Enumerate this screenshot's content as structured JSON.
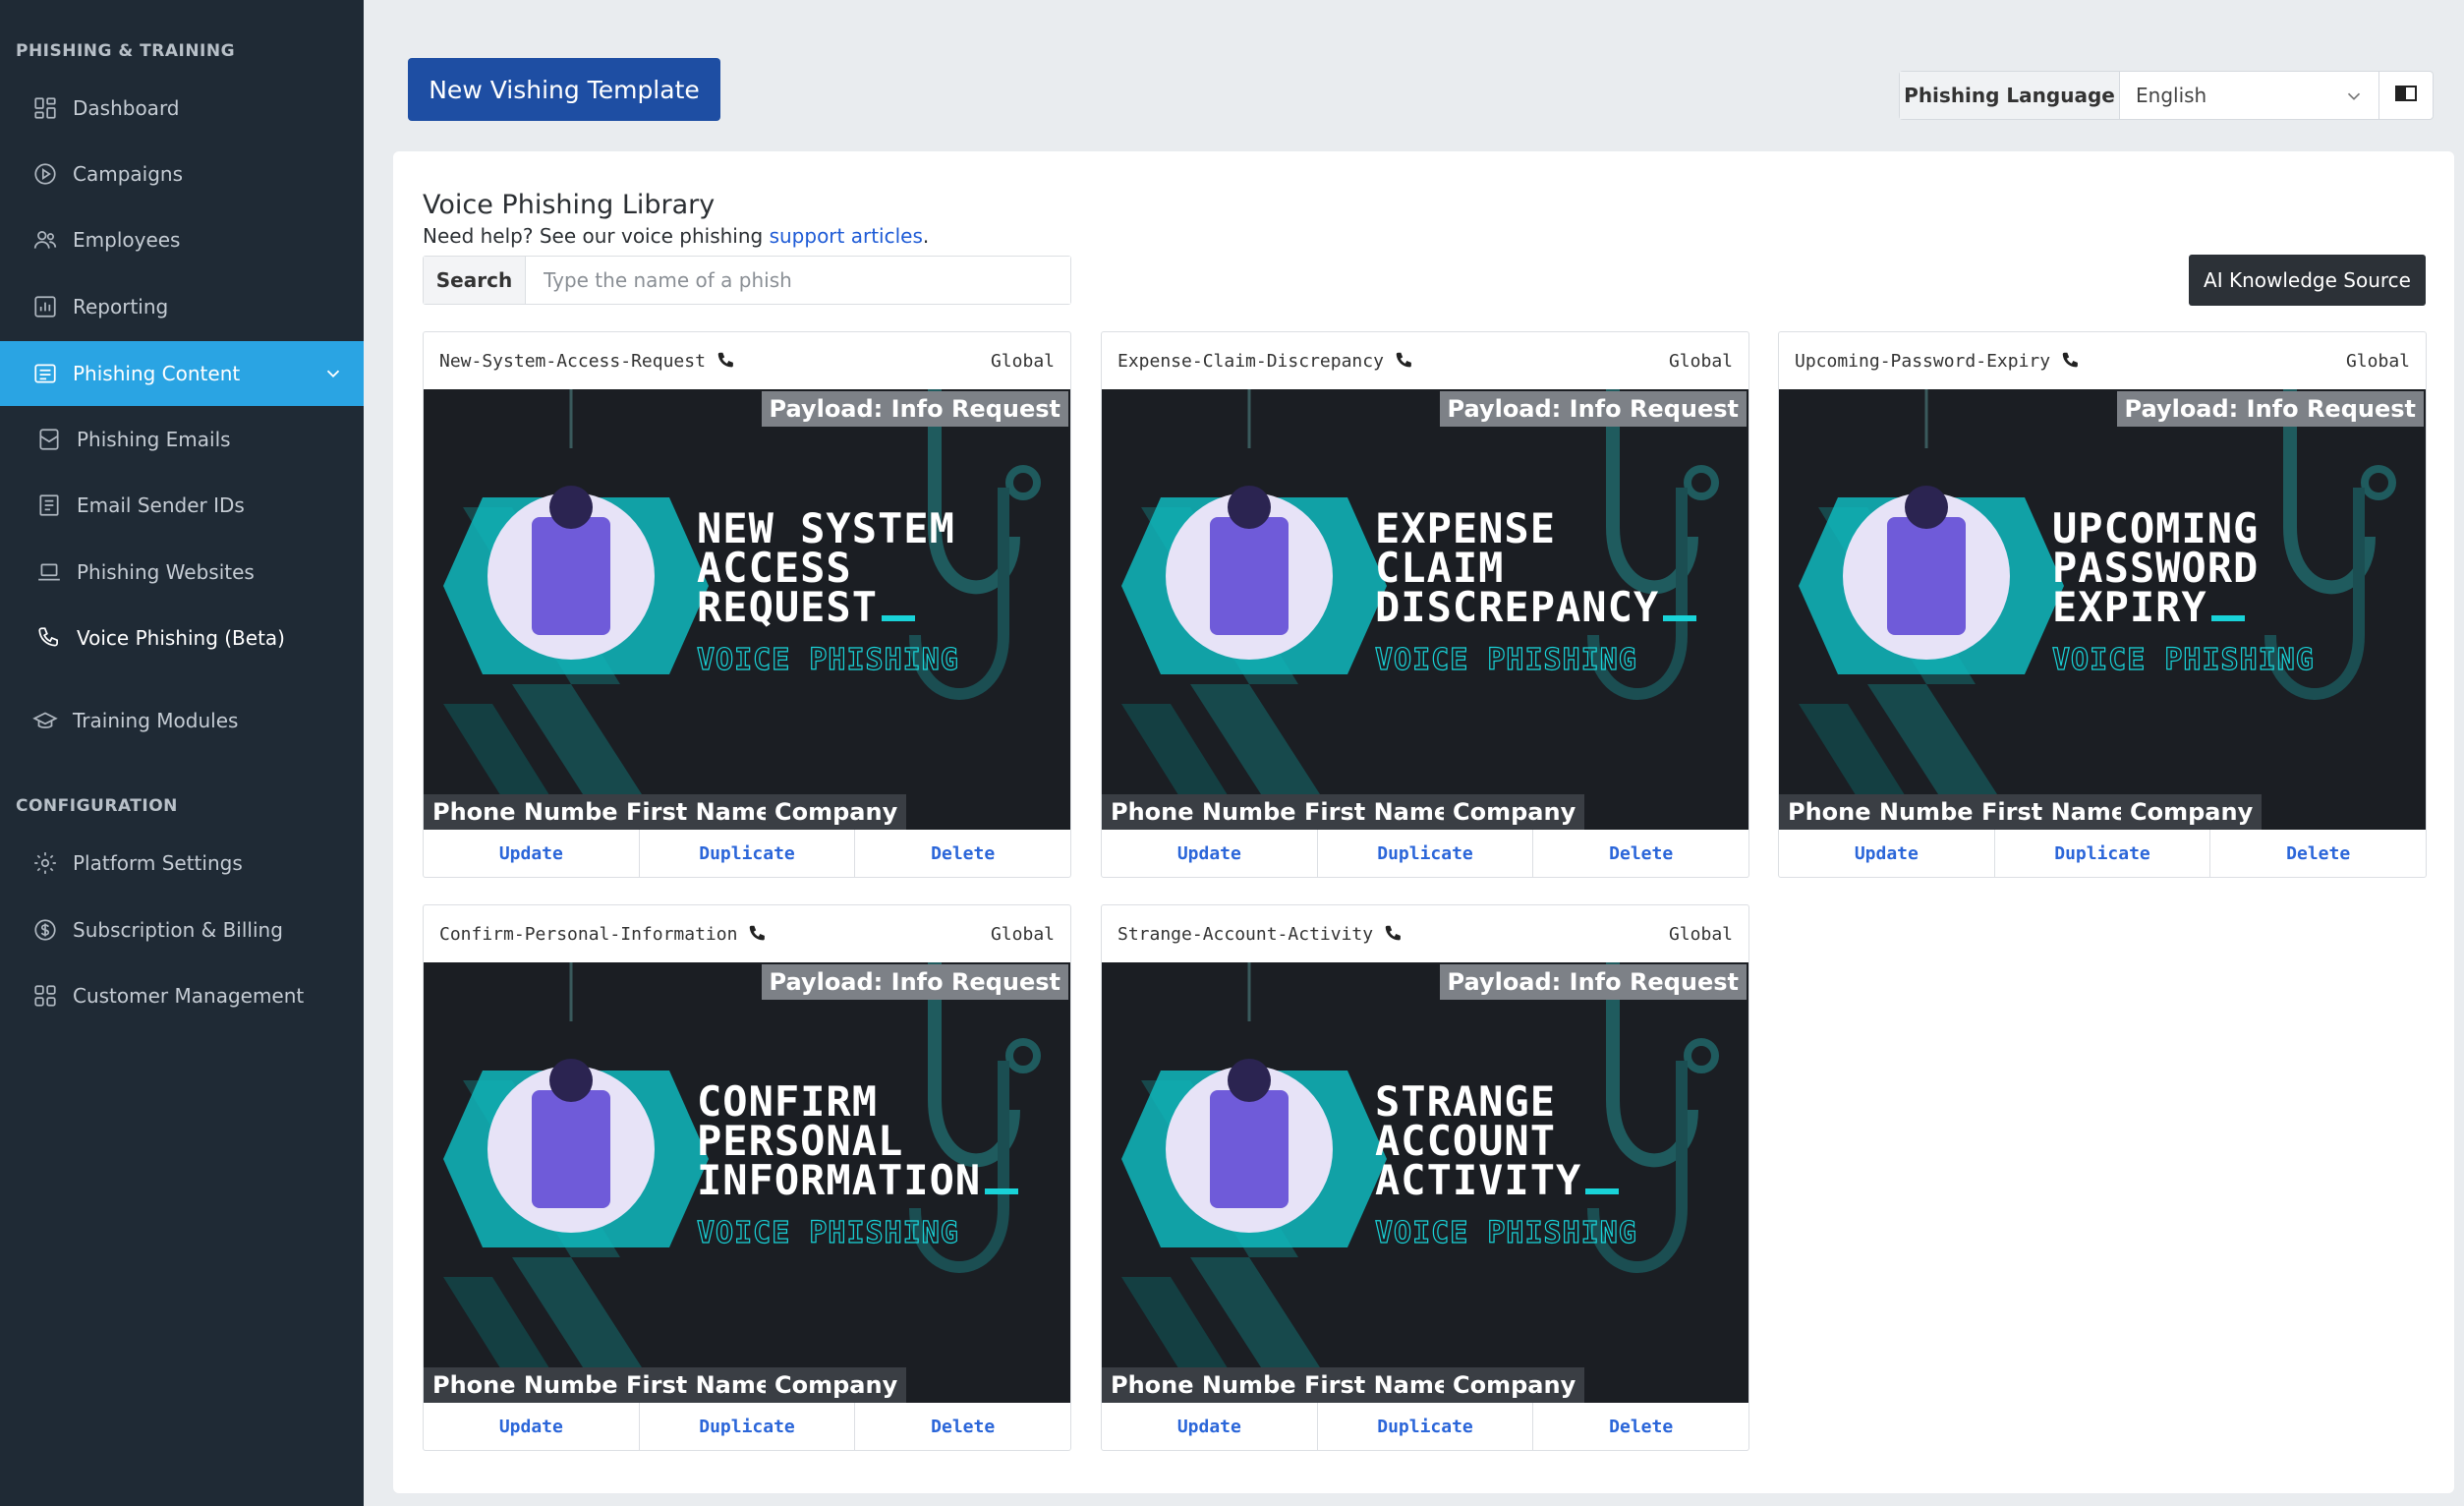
{
  "sidebar": {
    "section1": "PHISHING & TRAINING",
    "items": [
      {
        "label": "Dashboard",
        "icon": "dashboard-icon"
      },
      {
        "label": "Campaigns",
        "icon": "play-circle-icon"
      },
      {
        "label": "Employees",
        "icon": "users-icon"
      },
      {
        "label": "Reporting",
        "icon": "bar-chart-icon"
      },
      {
        "label": "Phishing Content",
        "icon": "content-icon"
      },
      {
        "label": "Phishing Emails",
        "icon": "email-icon"
      },
      {
        "label": "Email Sender IDs",
        "icon": "id-card-icon"
      },
      {
        "label": "Phishing Websites",
        "icon": "laptop-icon"
      },
      {
        "label": "Voice Phishing (Beta)",
        "icon": "phone-icon"
      },
      {
        "label": "Training Modules",
        "icon": "graduation-cap-icon"
      }
    ],
    "section2": "CONFIGURATION",
    "config_items": [
      {
        "label": "Platform Settings",
        "icon": "gear-icon"
      },
      {
        "label": "Subscription & Billing",
        "icon": "dollar-circle-icon"
      },
      {
        "label": "Customer Management",
        "icon": "grid-icon"
      }
    ]
  },
  "toolbar": {
    "new_template_label": "New Vishing Template",
    "language_label": "Phishing Language",
    "language_value": "English"
  },
  "library": {
    "title": "Voice Phishing Library",
    "help_prefix": "Need help? See our voice phishing ",
    "help_link": "support articles",
    "help_suffix": ".",
    "search_label": "Search",
    "search_placeholder": "Type the name of a phish",
    "ai_button": "AI Knowledge Source"
  },
  "card_common": {
    "payload": "Payload: Info Request",
    "scope": "Global",
    "subline": "VOICE PHISHING",
    "tags": [
      "Phone Number",
      "First Name",
      "Company"
    ],
    "actions": [
      "Update",
      "Duplicate",
      "Delete"
    ]
  },
  "cards": [
    {
      "name": "New-System-Access-Request",
      "line1": "NEW SYSTEM",
      "line2": "ACCESS",
      "line3": "REQUEST"
    },
    {
      "name": "Expense-Claim-Discrepancy",
      "line1": "EXPENSE",
      "line2": "CLAIM",
      "line3": "DISCREPANCY"
    },
    {
      "name": "Upcoming-Password-Expiry",
      "line1": "UPCOMING",
      "line2": "PASSWORD",
      "line3": "EXPIRY"
    },
    {
      "name": "Confirm-Personal-Information",
      "line1": "CONFIRM",
      "line2": "PERSONAL",
      "line3": "INFORMATION"
    },
    {
      "name": "Strange-Account-Activity",
      "line1": "STRANGE",
      "line2": "ACCOUNT",
      "line3": "ACTIVITY"
    }
  ],
  "colors": {
    "sidebar_bg": "#1f2a35",
    "active_item": "#2aa4e3",
    "primary_button": "#1e4ea3",
    "accent_teal": "#19d3d8",
    "link": "#1e5bd6"
  }
}
